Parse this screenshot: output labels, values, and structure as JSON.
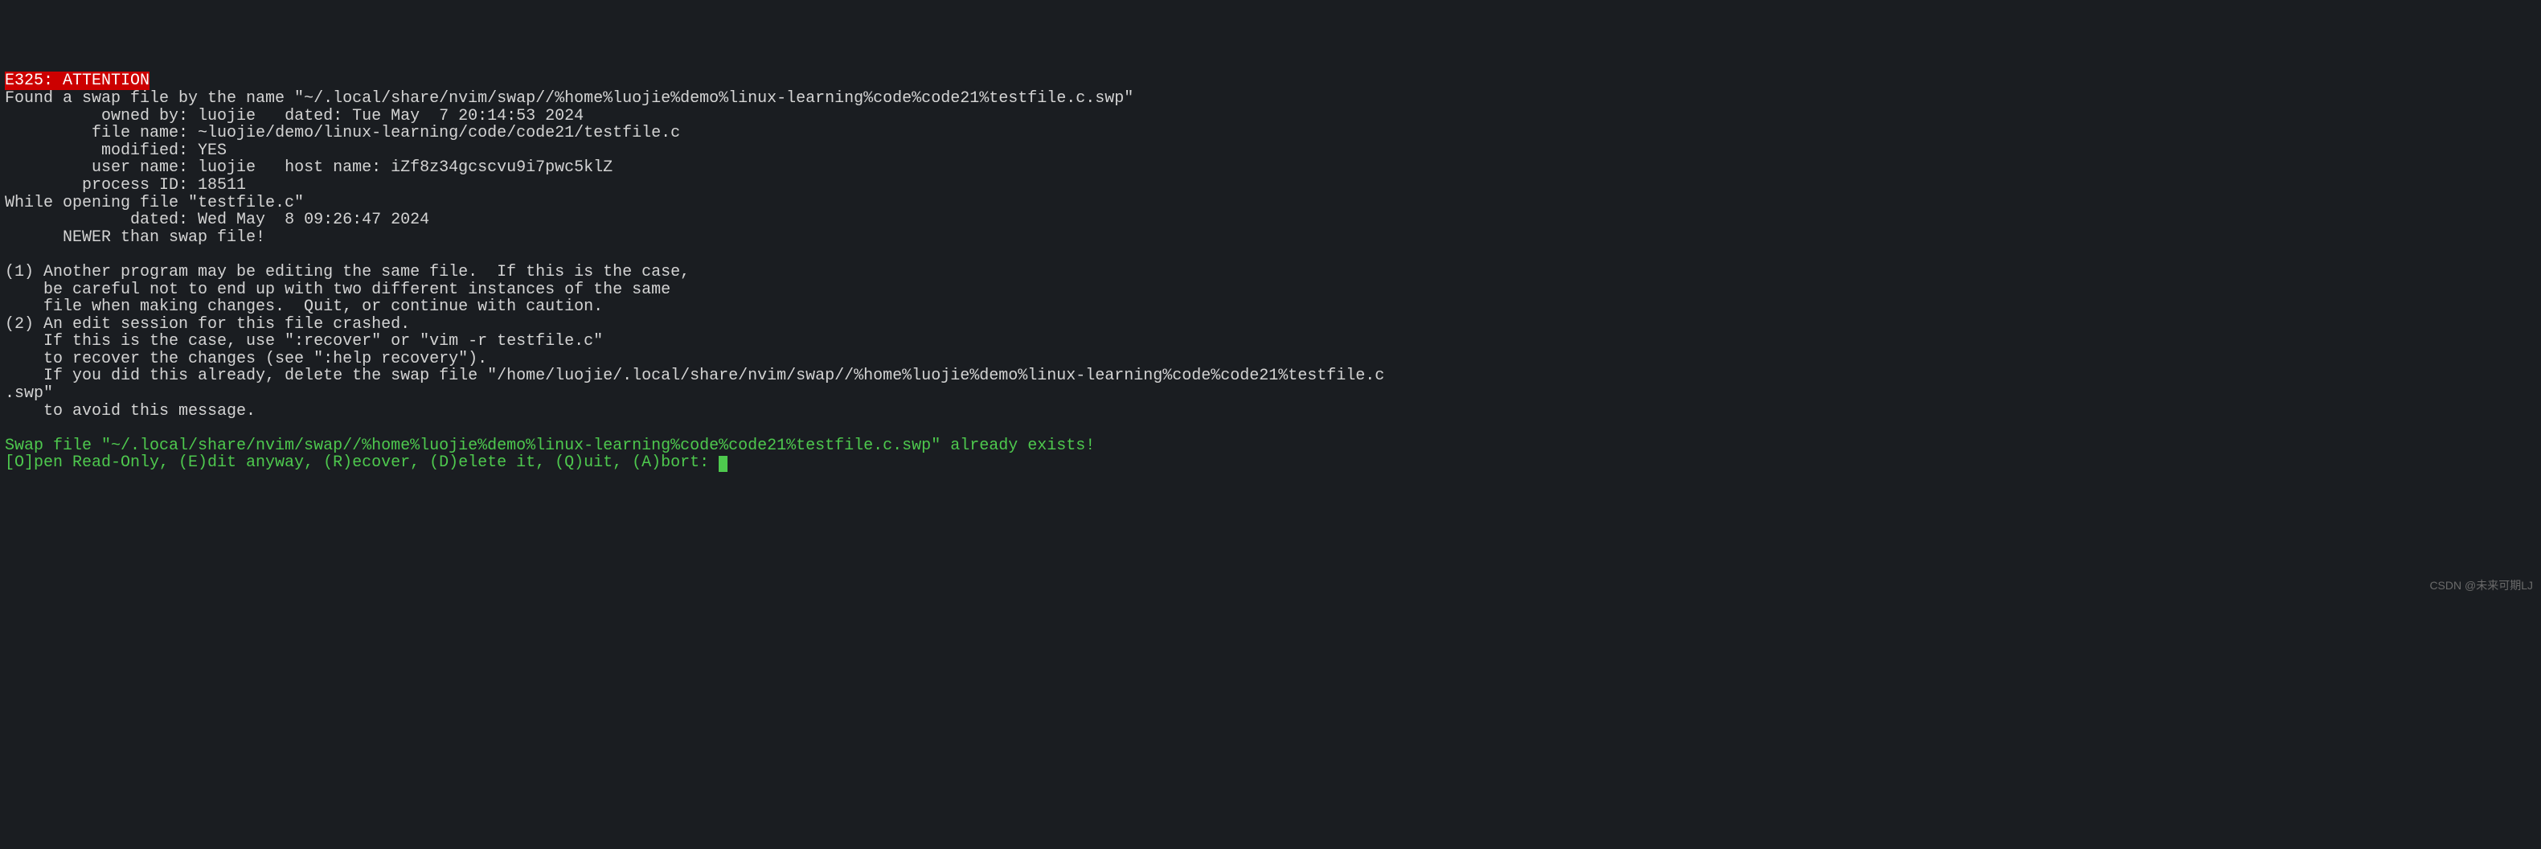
{
  "header": {
    "error_code": "E325: ATTENTION"
  },
  "swap_info": {
    "found_line": "Found a swap file by the name \"~/.local/share/nvim/swap//%home%luojie%demo%linux-learning%code%code21%testfile.c.swp\"",
    "owned_by_label": "          owned by: ",
    "owned_by_value": "luojie",
    "dated_label": "   dated: ",
    "dated_value": "Tue May  7 20:14:53 2024",
    "file_name_label": "         file name: ",
    "file_name_value": "~luojie/demo/linux-learning/code/code21/testfile.c",
    "modified_label": "          modified: ",
    "modified_value": "YES",
    "user_name_label": "         user name: ",
    "user_name_value": "luojie",
    "host_name_label": "   host name: ",
    "host_name_value": "iZf8z34gcscvu9i7pwc5klZ",
    "process_id_label": "        process ID: ",
    "process_id_value": "18511"
  },
  "opening": {
    "line": "While opening file \"testfile.c\"",
    "dated_label": "             dated: ",
    "dated_value": "Wed May  8 09:26:47 2024",
    "newer": "      NEWER than swap file!"
  },
  "advice": {
    "item1_line1": "(1) Another program may be editing the same file.  If this is the case,",
    "item1_line2": "    be careful not to end up with two different instances of the same",
    "item1_line3": "    file when making changes.  Quit, or continue with caution.",
    "item2_line1": "(2) An edit session for this file crashed.",
    "item2_line2": "    If this is the case, use \":recover\" or \"vim -r testfile.c\"",
    "item2_line3": "    to recover the changes (see \":help recovery\").",
    "item2_line4": "    If you did this already, delete the swap file \"/home/luojie/.local/share/nvim/swap//%home%luojie%demo%linux-learning%code%code21%testfile.c",
    "item2_line5": ".swp\"",
    "item2_line6": "    to avoid this message."
  },
  "prompt": {
    "exists_line": "Swap file \"~/.local/share/nvim/swap//%home%luojie%demo%linux-learning%code%code21%testfile.c.swp\" already exists!",
    "options": "[O]pen Read-Only, (E)dit anyway, (R)ecover, (D)elete it, (Q)uit, (A)bort: "
  },
  "watermark": "CSDN @未来可期LJ"
}
